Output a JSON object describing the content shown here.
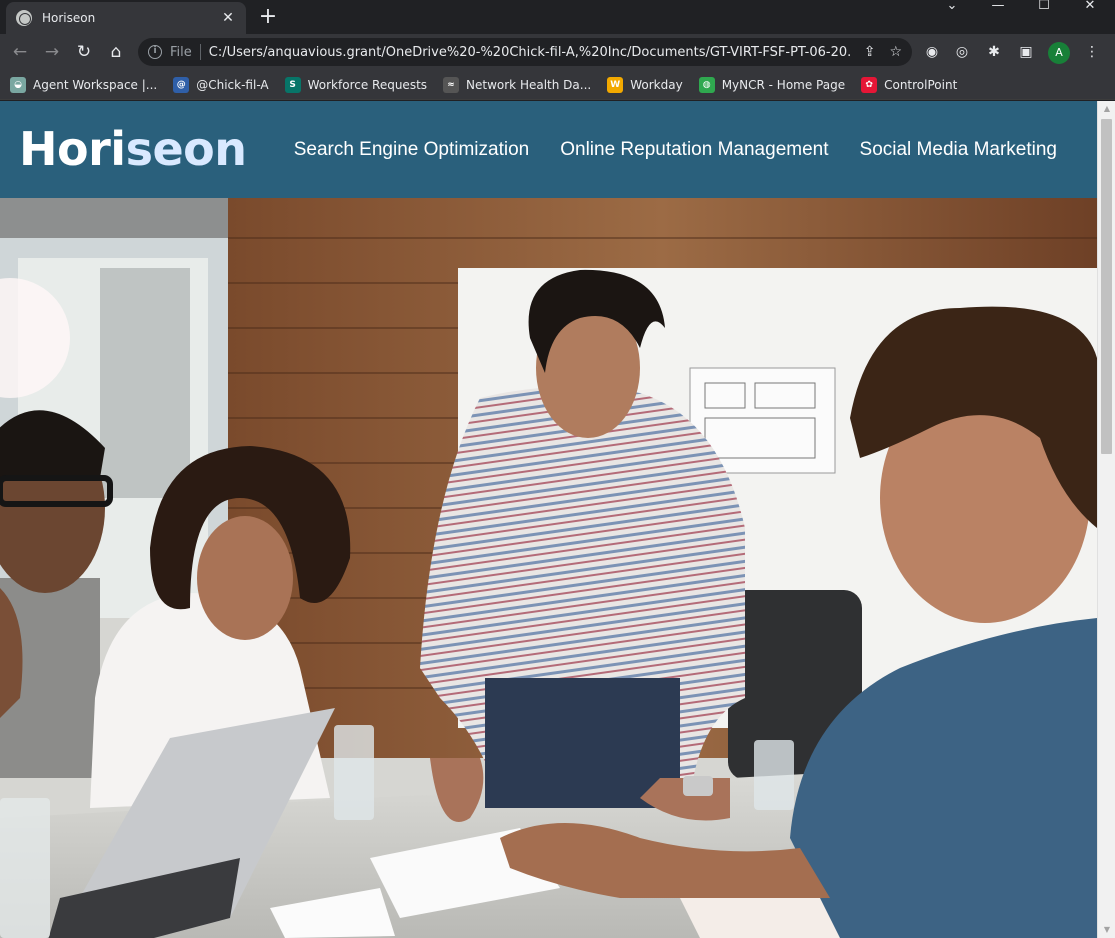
{
  "browser": {
    "tab_title": "Horiseon",
    "tab_close": "✕",
    "new_tab": "+",
    "window_controls": {
      "dropdown": "⌄",
      "minimize": "—",
      "maximize": "☐",
      "close": "✕"
    },
    "omnibox": {
      "scheme_label": "File",
      "url": "C:/Users/anquavious.grant/OneDrive%20-%20Chick-fil-A,%20Inc/Documents/GT-VIRT-FSF-PT-06-20..."
    },
    "profile_initial": "A",
    "bookmarks": [
      {
        "label": "Agent Workspace |...",
        "icon": "agent-workspace-icon",
        "color": "#7aa7a1"
      },
      {
        "label": "@Chick-fil-A",
        "icon": "at-icon",
        "color": "#2f5fa8"
      },
      {
        "label": "Workforce Requests",
        "icon": "sharepoint-icon",
        "color": "#077568"
      },
      {
        "label": "Network Health Da...",
        "icon": "network-health-icon",
        "color": "#555555"
      },
      {
        "label": "Workday",
        "icon": "workday-icon",
        "color": "#f2a900"
      },
      {
        "label": "MyNCR - Home Page",
        "icon": "myncr-icon",
        "color": "#2fa84f"
      },
      {
        "label": "ControlPoint",
        "icon": "chick-fil-a-icon",
        "color": "#e51636"
      }
    ]
  },
  "site": {
    "logo_part1": "Hori",
    "logo_part2": "seon",
    "nav": [
      "Search Engine Optimization",
      "Online Reputation Management",
      "Social Media Marketing"
    ],
    "colors": {
      "header_bg": "#2a607c",
      "logo_accent": "#d9e9ff"
    }
  }
}
